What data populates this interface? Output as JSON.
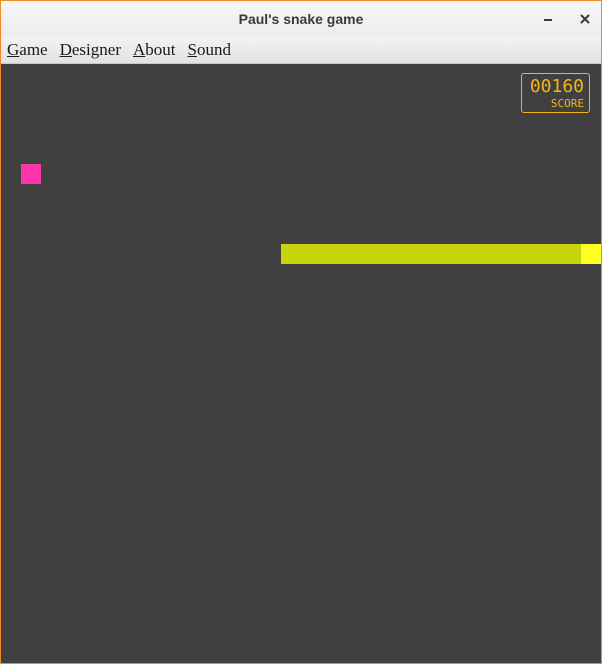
{
  "window": {
    "title": "Paul's snake game",
    "minimize_icon": "minimize-icon",
    "close_icon": "close-icon"
  },
  "menu": {
    "items": [
      {
        "mnemonic": "G",
        "rest": "ame"
      },
      {
        "mnemonic": "D",
        "rest": "esigner"
      },
      {
        "mnemonic": "A",
        "rest": "bout"
      },
      {
        "mnemonic": "S",
        "rest": "ound"
      }
    ]
  },
  "score": {
    "value": "00160",
    "label": "SCORE"
  },
  "colors": {
    "background": "#404040",
    "food": "#ff33aa",
    "snake_body": "#c6d60a",
    "snake_head": "#ffff22",
    "score": "#f2b51a",
    "window_border": "#f08a24"
  }
}
